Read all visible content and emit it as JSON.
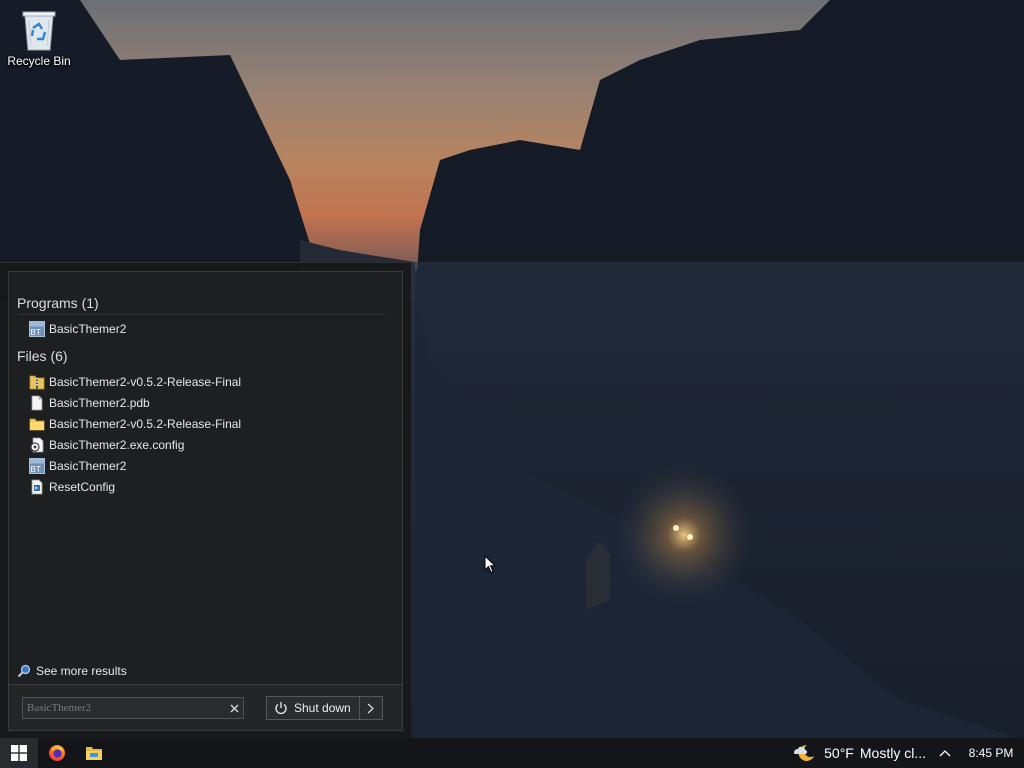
{
  "desktop": {
    "icons": [
      {
        "label": "Recycle Bin",
        "icon": "recycle-bin-icon"
      }
    ]
  },
  "start_menu": {
    "groups": [
      {
        "header": "Programs (1)",
        "items": [
          {
            "label": "BasicThemer2",
            "icon": "app-icon"
          }
        ]
      },
      {
        "header": "Files (6)",
        "items": [
          {
            "label": "BasicThemer2-v0.5.2-Release-Final",
            "icon": "zip-folder-icon"
          },
          {
            "label": "BasicThemer2.pdb",
            "icon": "file-icon"
          },
          {
            "label": "BasicThemer2-v0.5.2-Release-Final",
            "icon": "folder-icon"
          },
          {
            "label": "BasicThemer2.exe.config",
            "icon": "config-file-icon"
          },
          {
            "label": "BasicThemer2",
            "icon": "app-icon"
          },
          {
            "label": "ResetConfig",
            "icon": "script-file-icon"
          }
        ]
      }
    ],
    "see_more_label": "See more results",
    "search": {
      "placeholder": "BasicThemer2",
      "clear_icon": "close-icon"
    },
    "shutdown_label": "Shut down"
  },
  "taskbar": {
    "pinned": [
      "windows-start-icon",
      "firefox-icon",
      "file-explorer-icon"
    ],
    "weather": {
      "temperature": "50°F",
      "condition": "Mostly cl...",
      "icon": "moon-cloud-icon"
    },
    "tray_chevron_icon": "chevron-up-icon",
    "clock": "8:45 PM"
  }
}
